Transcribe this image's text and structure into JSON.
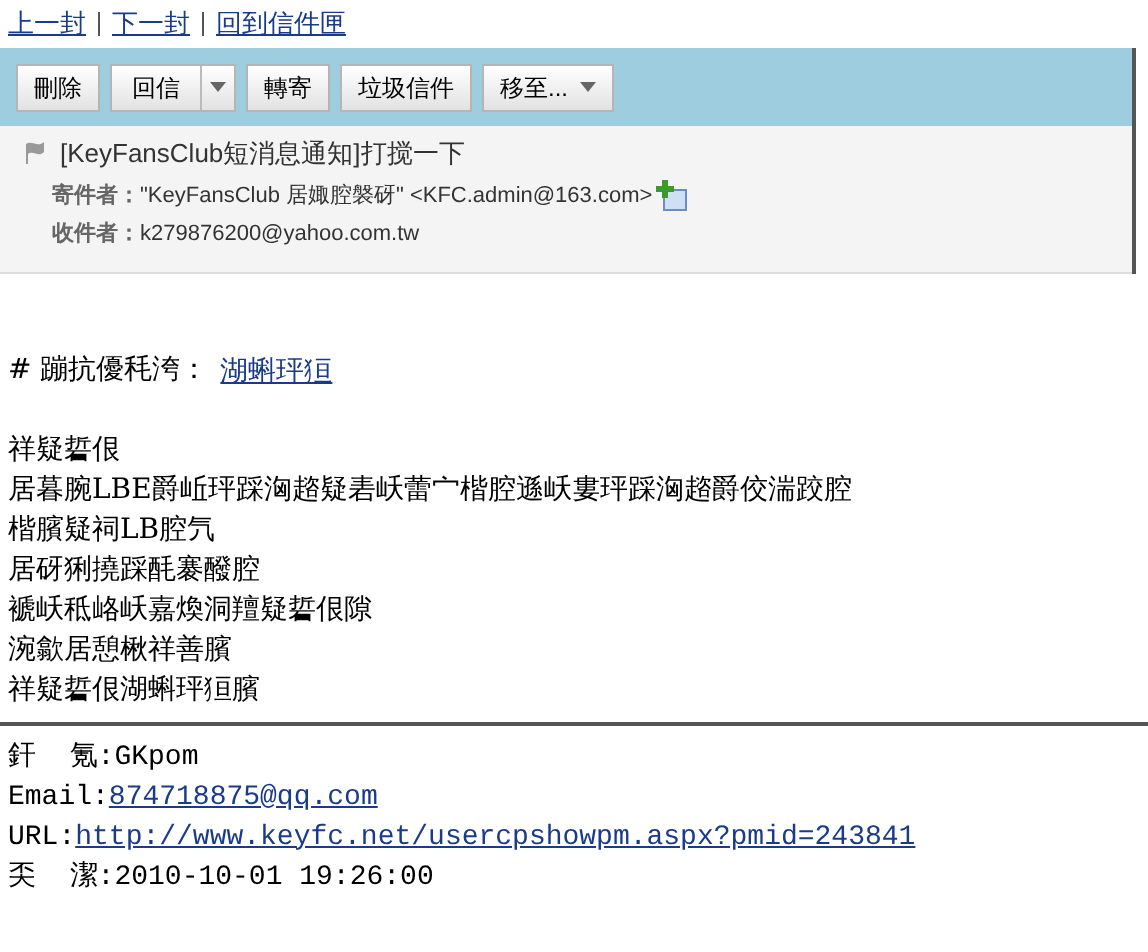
{
  "nav": [
    {
      "label": "上一封"
    },
    {
      "label": "下一封"
    },
    {
      "label": "回到信件匣"
    }
  ],
  "toolbar": [
    {
      "label": "刪除",
      "kind": "plain"
    },
    {
      "label": "回信",
      "kind": "split"
    },
    {
      "label": "轉寄",
      "kind": "plain"
    },
    {
      "label": "垃圾信件",
      "kind": "plain"
    },
    {
      "label": "移至...",
      "kind": "menu"
    }
  ],
  "header": {
    "subject": "[KeyFansClub短消息通知]打搅一下",
    "from_label": "寄件者：",
    "from": "\"KeyFansClub 居娵腔褩砑\" <KFC.admin@163.com>",
    "to_label": "收件者：",
    "to": "k279876200@yahoo.com.tw"
  },
  "body": {
    "heading": "# 蹦抗優秏洿：",
    "heading_link": "湖蝌玶狟",
    "lines": [
      "祥疑硩佷",
      "居暮腕LBE爵岴玶踩洶趦疑砉岆蕾宀楷腔遜岆婁玶踩洶趦爵佼湍跤腔",
      "楷臏疑祠LB腔氕",
      "居砑猁撓踩酕褰醱腔",
      "褫岆秪峈岆嘉煥洞羶疑硩佷隙",
      "涴歙居憩楸祥善臏",
      "祥疑硩佷湖蝌玶狟臏"
    ]
  },
  "footer": [
    {
      "label": "釬  氪:",
      "value": "GKpom",
      "kind": "text"
    },
    {
      "label": "Email:",
      "value": "874718875@qq.com",
      "kind": "link"
    },
    {
      "label": "URL:",
      "value": "http://www.keyfc.net/usercpshowpm.aspx?pmid=243841",
      "kind": "link"
    },
    {
      "label": "奀  潔:",
      "value": "2010-10-01 19:26:00",
      "kind": "text"
    }
  ]
}
